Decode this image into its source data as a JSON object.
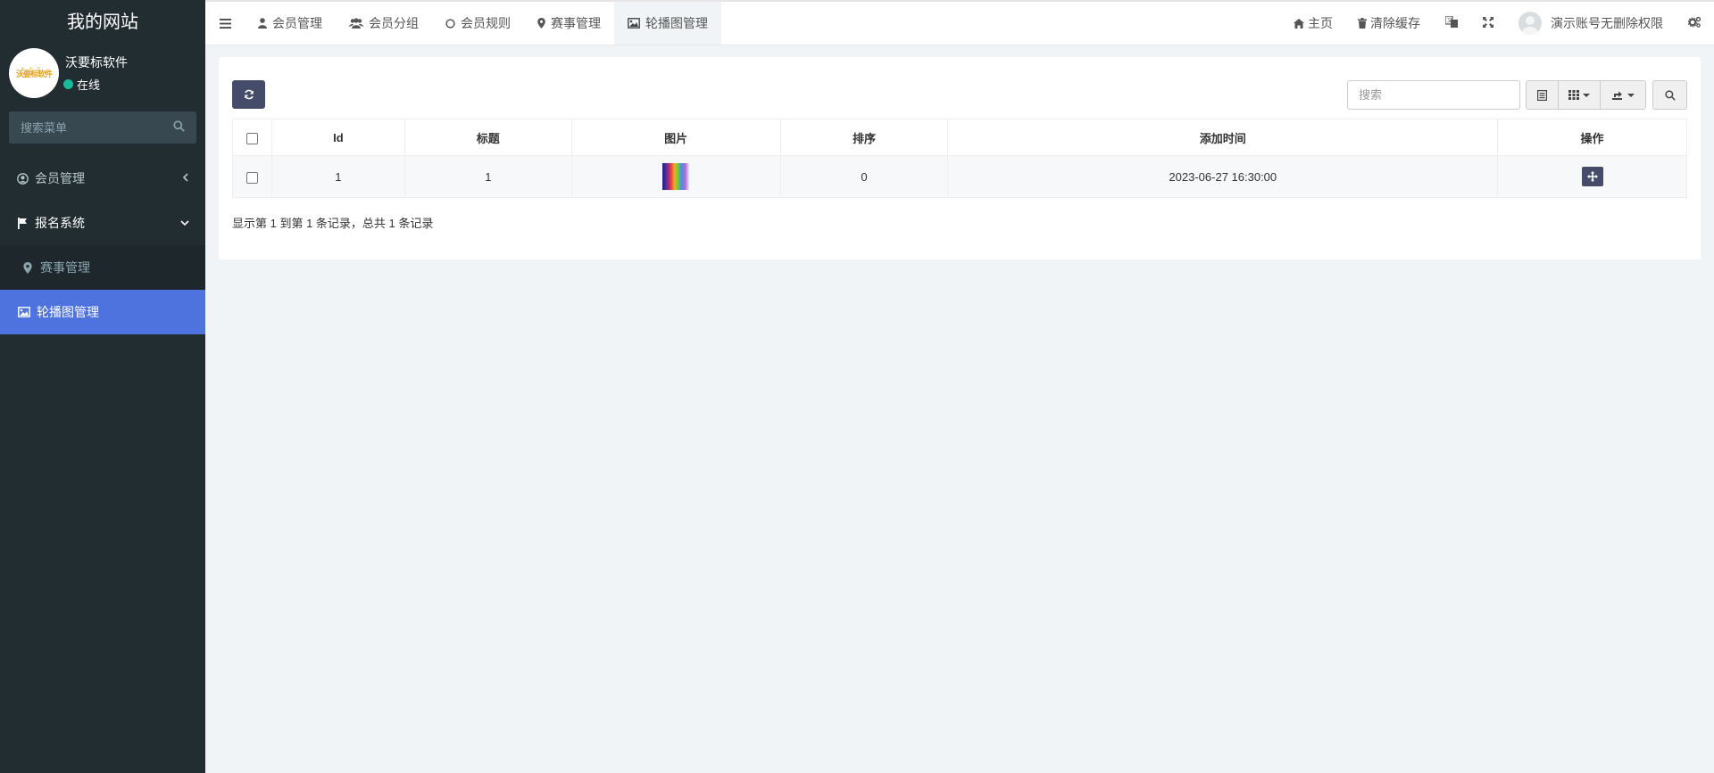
{
  "site": {
    "title": "我的网站"
  },
  "user": {
    "name": "沃要标软件",
    "status": "在线",
    "avatar_text": "沃要标软件"
  },
  "sidebar": {
    "search_placeholder": "搜索菜单",
    "items": [
      {
        "label": "会员管理",
        "icon": "user-circle-icon"
      },
      {
        "label": "报名系统",
        "icon": "flag-icon",
        "children": [
          {
            "label": "赛事管理",
            "icon": "map-marker-icon"
          },
          {
            "label": "轮播图管理",
            "icon": "image-icon"
          }
        ]
      }
    ]
  },
  "topbar": {
    "tabs": [
      {
        "label": "会员管理",
        "icon": "user-icon"
      },
      {
        "label": "会员分组",
        "icon": "users-icon"
      },
      {
        "label": "会员规则",
        "icon": "circle-icon"
      },
      {
        "label": "赛事管理",
        "icon": "map-marker-icon"
      },
      {
        "label": "轮播图管理",
        "icon": "image-icon",
        "active": true
      }
    ],
    "home_label": "主页",
    "clear_cache_label": "清除缓存",
    "account_label": "演示账号无删除权限"
  },
  "toolbar": {
    "search_placeholder": "搜索"
  },
  "table": {
    "headers": [
      "Id",
      "标题",
      "图片",
      "排序",
      "添加时间",
      "操作"
    ],
    "rows": [
      {
        "id": "1",
        "title": "1",
        "sort": "0",
        "created": "2023-06-27 16:30:00"
      }
    ]
  },
  "pagination": {
    "info": "显示第 1 到第 1 条记录，总共 1 条记录"
  }
}
